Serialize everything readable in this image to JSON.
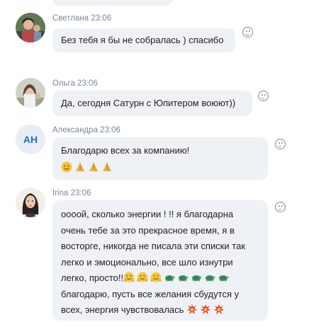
{
  "messages": [
    {
      "author": "Светлана",
      "time": "23:06",
      "avatar_icon": "user-photo-icon",
      "lines": [
        "Без тебя я бы не собралась ) спасибо"
      ]
    },
    {
      "author": "Ольга",
      "time": "23:06",
      "avatar_icon": "user-photo-icon",
      "lines": [
        "Да, сегодня Сатурн с Юпитером воюют))"
      ]
    },
    {
      "author": "Александра",
      "time": "23:06",
      "avatar_initials": "AH",
      "lines": [
        "Благодарю всех за компанию!"
      ],
      "emoji_line": [
        "smiling-face-emoji",
        "folded-hands-emoji",
        "folded-hands-emoji",
        "folded-hands-emoji"
      ]
    },
    {
      "author": "Irina",
      "time": "23:06",
      "avatar_icon": "user-photo-icon",
      "lines": [
        "оооой, сколько энергии ! !! я благодарна",
        "очень тебе за это прекрасное время,  я в",
        "восторге, никогда не писала эти списки так",
        "легко и эмоционально,   все шло изнутри",
        "легко,  просто!!",
        " благодарю,  пусть все желания сбудутся у",
        "всех, энергия чувствовалась"
      ],
      "inline_emoji_after_line5": [
        "hugging-face-emoji",
        "hugging-face-emoji",
        "hugging-face-emoji",
        "turtle-emoji",
        "turtle-emoji",
        "turtle-emoji",
        "turtle-emoji",
        "turtle-emoji"
      ],
      "inline_emoji_after_line7": [
        "collision-emoji",
        "collision-emoji",
        "collision-emoji"
      ]
    }
  ],
  "reaction_icon": "add-reaction-icon"
}
